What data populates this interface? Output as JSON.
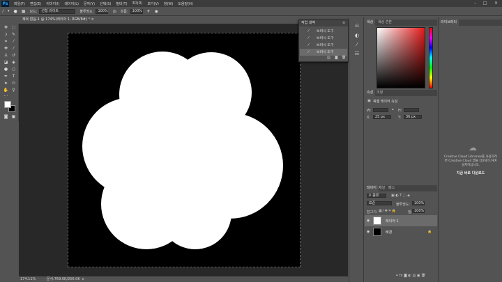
{
  "app": {
    "logo": "Ps"
  },
  "menu": [
    "파일(F)",
    "편집(E)",
    "이미지(I)",
    "레이어(L)",
    "문자(Y)",
    "선택(S)",
    "필터(T)",
    "3D(D)",
    "보기(V)",
    "창(W)",
    "도움말(H)"
  ],
  "options": {
    "mode_label": "모드:",
    "mode_value": "선형 라이트",
    "opacity_label": "불투명도:",
    "opacity_value": "100%",
    "flow_label": "흐름:",
    "flow_value": "100%"
  },
  "document": {
    "tab_title": "제목 없음-1 @ 174%(레이어 1, RGB/8#) *",
    "status_zoom": "174.11%",
    "status_doc": "문서:769.0K/256.0K"
  },
  "history": {
    "title": "작업 내역",
    "items": [
      "브러시 도구",
      "브러시 도구",
      "브러시 도구",
      "브러시 도구"
    ]
  },
  "color_panel": {
    "tabs": [
      "색상",
      "색상 견본"
    ],
    "hue_color": "#e51b1b"
  },
  "properties": {
    "tabs": [
      "속성",
      "조정"
    ],
    "title": "픽셀 레이어 속성",
    "w_label": "W:",
    "h_label": "H:",
    "x_label": "X:",
    "x_value": "25 px",
    "y_label": "Y:",
    "y_value": "36 px"
  },
  "layers_panel": {
    "tabs": [
      "레이어",
      "채널",
      "패스"
    ],
    "filter_label": "종류",
    "blend_mode": "표준",
    "opacity_label": "불투명도:",
    "opacity_value": "100%",
    "lock_label": "잠그기:",
    "fill_label": "칠:",
    "fill_value": "100%",
    "layers": [
      {
        "name": "레이어 1"
      },
      {
        "name": "배경"
      }
    ]
  },
  "libraries": {
    "tab": "라이브러리",
    "message": "Creative Cloud Libraries를 사용하려면 Creative Cloud 앱을 다운로드하여 설치하십시오.",
    "link": "지금 바로 다운로드"
  }
}
